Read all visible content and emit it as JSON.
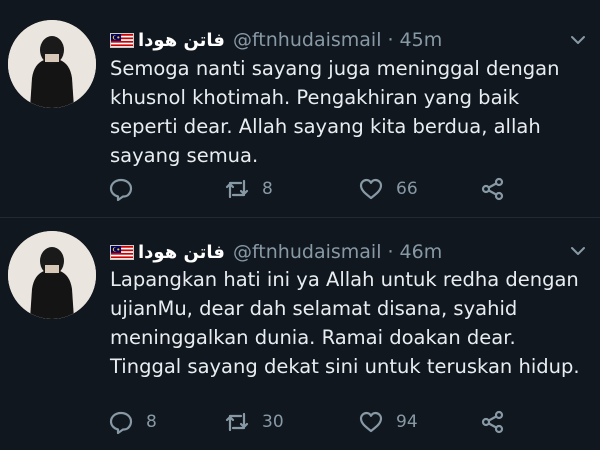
{
  "tweets": [
    {
      "name": "فاتن هودا",
      "handle": "@ftnhudaismail",
      "time": "45m",
      "separator": "·",
      "text": "Semoga nanti sayang juga meninggal dengan khusnol khotimah. Pengakhiran yang baik seperti dear. Allah sayang kita berdua, allah sayang semua.",
      "replies": "",
      "retweets": "8",
      "likes": "66"
    },
    {
      "name": "فاتن هودا",
      "handle": "@ftnhudaismail",
      "time": "46m",
      "separator": "·",
      "text": "Lapangkan hati ini ya Allah untuk redha dengan ujianMu, dear dah selamat disana, syahid meninggalkan dunia. Ramai doakan dear. Tinggal sayang dekat sini untuk teruskan hidup.",
      "replies": "8",
      "retweets": "30",
      "likes": "94"
    }
  ],
  "icons": {
    "reply": "reply-icon",
    "retweet": "retweet-icon",
    "like": "heart-icon",
    "share": "share-icon",
    "more": "chevron-down-icon",
    "flag": "malaysia-flag-icon"
  },
  "colors": {
    "background": "#10171e",
    "text": "#e8edf1",
    "muted": "#8899a6"
  }
}
